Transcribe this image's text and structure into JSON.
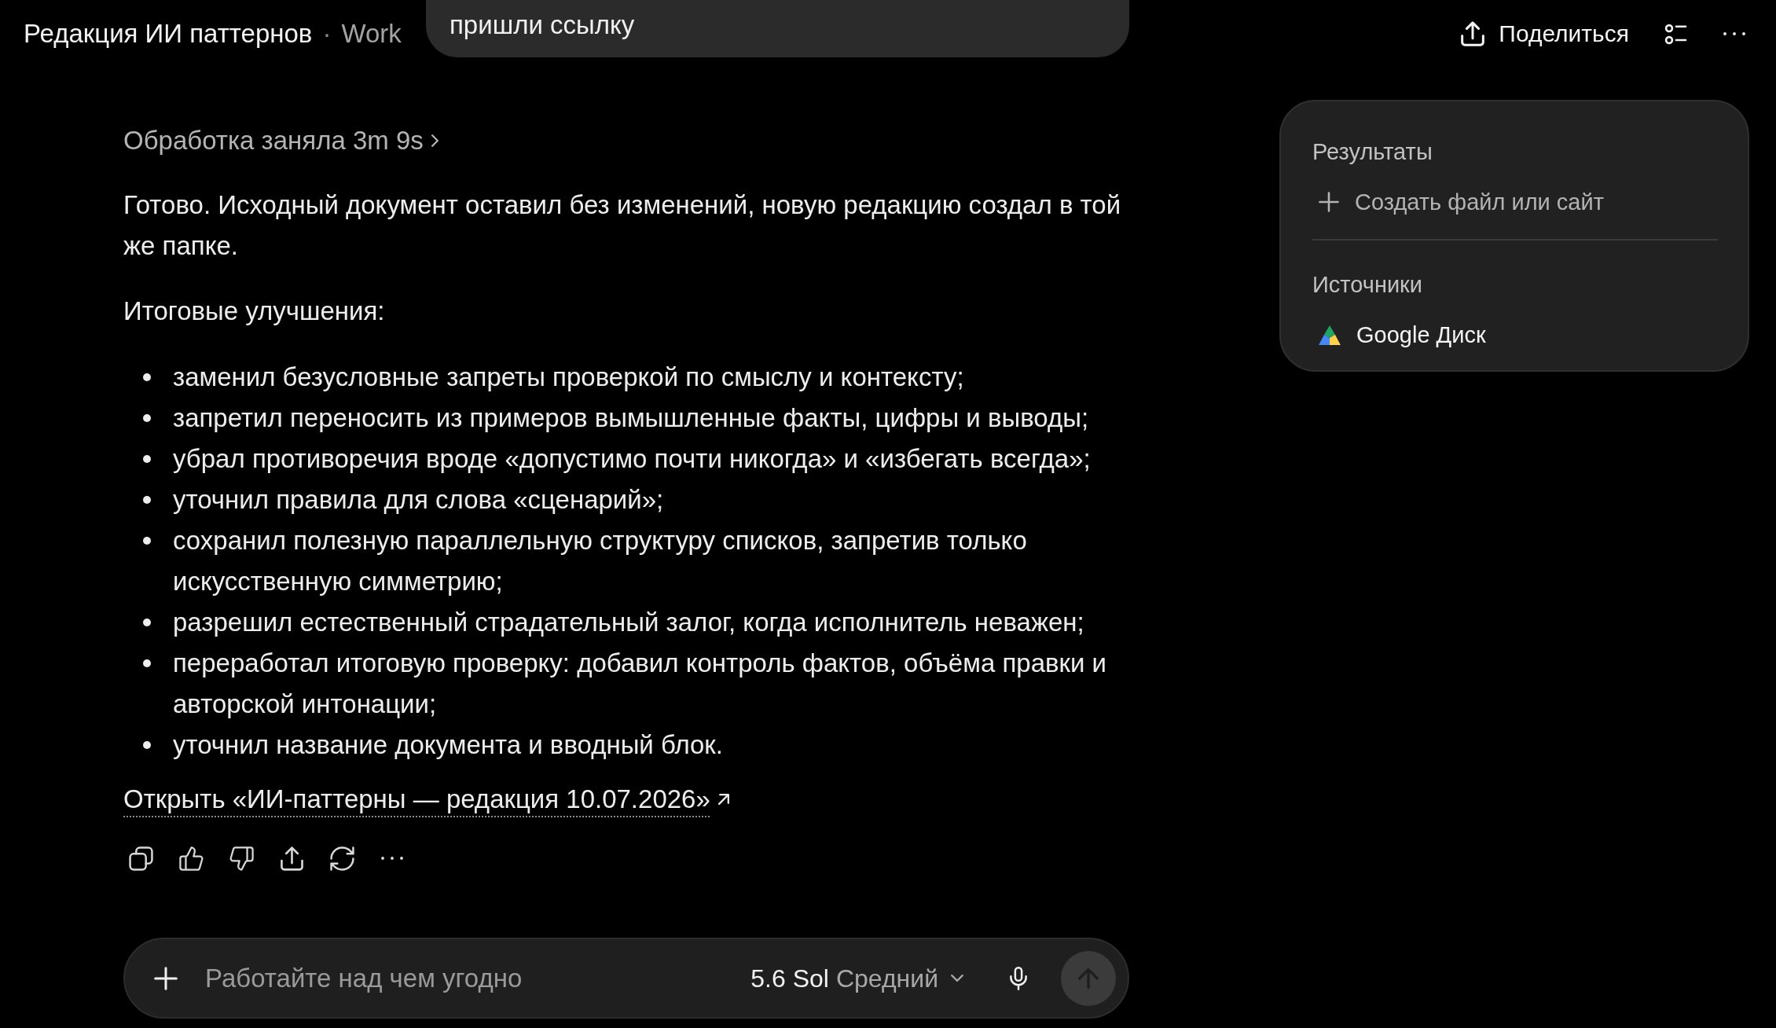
{
  "header": {
    "title": "Редакция ИИ паттернов",
    "separator": "·",
    "project": "Work"
  },
  "user_message": {
    "text": "пришли ссылку"
  },
  "top_actions": {
    "share_label": "Поделиться"
  },
  "response": {
    "thinking": "Обработка заняла 3m 9s",
    "paragraphs": [
      "Готово. Исходный документ оставил без изменений, новую редакцию создал в той же папке.",
      "Итоговые улучшения:"
    ],
    "bullets": [
      "заменил безусловные запреты проверкой по смыслу и контексту;",
      "запретил переносить из примеров вымышленные факты, цифры и выводы;",
      "убрал противоречия вроде «допустимо почти никогда» и «избегать всегда»;",
      "уточнил правила для слова «сценарий»;",
      "сохранил полезную параллельную структуру списков, запретив только искусственную симметрию;",
      "разрешил естественный страдательный залог, когда исполнитель неважен;",
      "переработал итоговую проверку: добавил контроль фактов, объёма правки и авторской интонации;",
      "уточнил название документа и вводный блок."
    ],
    "link": "Открыть «ИИ-паттерны — редакция 10.07.2026»"
  },
  "side_panel": {
    "sections": [
      {
        "title": "Результаты",
        "items": [
          {
            "kind": "create",
            "label": "Создать файл или сайт"
          }
        ]
      },
      {
        "title": "Источники",
        "items": [
          {
            "kind": "source",
            "label": "Google Диск"
          }
        ]
      }
    ]
  },
  "composer": {
    "placeholder": "Работайте над чем угодно",
    "model": "5.6 Sol",
    "effort": "Средний",
    "send_disabled": true
  }
}
